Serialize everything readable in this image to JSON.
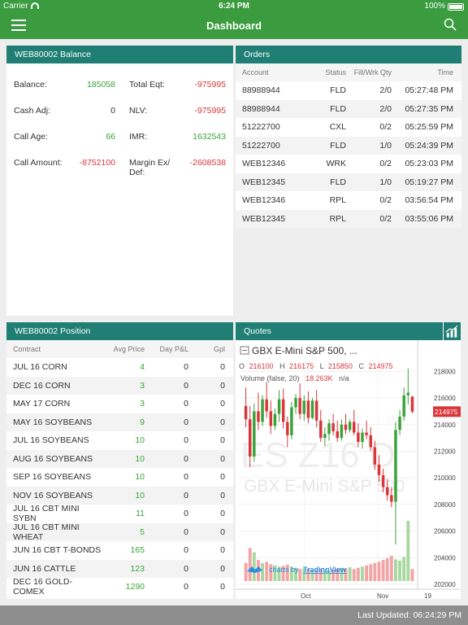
{
  "statusbar": {
    "carrier": "Carrier",
    "time": "6:24 PM",
    "battery": "100%"
  },
  "nav": {
    "title": "Dashboard"
  },
  "balance": {
    "header": "WEB80002 Balance",
    "rows": [
      {
        "l1": "Balance:",
        "v1": "185058",
        "l2": "Total Eqt:",
        "v2": "-975995"
      },
      {
        "l1": "Cash Adj:",
        "v1": "0",
        "l2": "NLV:",
        "v2": "-975995"
      },
      {
        "l1": "Call Age:",
        "v1": "66",
        "l2": "IMR:",
        "v2": "1632543"
      },
      {
        "l1": "Call Amount:",
        "v1": "-8752100",
        "l2": "Margin Ex/ Def:",
        "v2": "-2608538"
      }
    ]
  },
  "orders": {
    "header": "Orders",
    "columns": [
      "Account",
      "Status",
      "Fill/Wrk Qty",
      "Time"
    ],
    "rows": [
      [
        "88988944",
        "FLD",
        "2/0",
        "05:27:48 PM"
      ],
      [
        "88988944",
        "FLD",
        "2/0",
        "05:27:35 PM"
      ],
      [
        "51222700",
        "CXL",
        "0/2",
        "05:25:59 PM"
      ],
      [
        "51222700",
        "FLD",
        "1/0",
        "05:24:39 PM"
      ],
      [
        "WEB12346",
        "WRK",
        "0/2",
        "05:23:03 PM"
      ],
      [
        "WEB12345",
        "FLD",
        "1/0",
        "05:19:27 PM"
      ],
      [
        "WEB12346",
        "RPL",
        "0/2",
        "03:56:54 PM"
      ],
      [
        "WEB12345",
        "RPL",
        "0/2",
        "03:55:06 PM"
      ]
    ]
  },
  "position": {
    "header": "WEB80002 Position",
    "columns": [
      "Contract",
      "Avg Price",
      "Day P&L",
      "Gpl"
    ],
    "rows": [
      [
        "JUL 16 CORN",
        "4",
        "0",
        "0"
      ],
      [
        "DEC 16 CORN",
        "3",
        "0",
        "0"
      ],
      [
        "MAY 17 CORN",
        "3",
        "0",
        "0"
      ],
      [
        "MAY 16 SOYBEANS",
        "9",
        "0",
        "0"
      ],
      [
        "JUL 16 SOYBEANS",
        "10",
        "0",
        "0"
      ],
      [
        "AUG 16 SOYBEANS",
        "10",
        "0",
        "0"
      ],
      [
        "SEP 16 SOYBEANS",
        "10",
        "0",
        "0"
      ],
      [
        "NOV 16 SOYBEANS",
        "10",
        "0",
        "0"
      ],
      [
        "JUL 16 CBT MINI SYBN",
        "11",
        "0",
        "0"
      ],
      [
        "JUL 16 CBT MINI WHEAT",
        "5",
        "0",
        "0"
      ],
      [
        "JUN 16 CBT T-BONDS",
        "165",
        "0",
        "0"
      ],
      [
        "JUN 16 CATTLE",
        "123",
        "0",
        "0"
      ],
      [
        "DEC 16 GOLD-COMEX",
        "1290",
        "0",
        "0"
      ]
    ]
  },
  "quotes": {
    "header": "Quotes",
    "chart_icon": "chart-icon",
    "symbol_title": "GBX E-Mini S&P 500, ...",
    "ohlc": {
      "o_label": "O",
      "o": "216100",
      "h_label": "H",
      "h": "216175",
      "l_label": "L",
      "l": "215850",
      "c_label": "C",
      "c": "214975"
    },
    "volume_label": "Volume (false, 20)",
    "volume_value": "18.263K",
    "volume_na": "n/a",
    "watermark_1": "ES Z16 D",
    "watermark_2": "GBX E-Mini S&P 500",
    "branding_prefix": "charts by",
    "branding": "TradingView",
    "current_price": "214975",
    "colors": {
      "up": "#3ba33a",
      "down": "#d9363a",
      "vol_up": "#a7d89f",
      "vol_down": "#f2a4a6"
    }
  },
  "chart_data": {
    "type": "candlestick",
    "title": "GBX E-Mini S&P 500, ...",
    "y_ticks": [
      "218000",
      "216000",
      "214000",
      "212000",
      "210000",
      "208000",
      "206000",
      "204000",
      "202000"
    ],
    "ylim": [
      202000,
      219000
    ],
    "x_ticks": [
      "Oct",
      "Nov",
      "19"
    ],
    "candles": [
      {
        "o": 215400,
        "h": 216800,
        "l": 213800,
        "c": 214400
      },
      {
        "o": 214400,
        "h": 215400,
        "l": 210800,
        "c": 211600
      },
      {
        "o": 211600,
        "h": 215600,
        "l": 211200,
        "c": 215000
      },
      {
        "o": 215000,
        "h": 216400,
        "l": 213600,
        "c": 214200
      },
      {
        "o": 214200,
        "h": 216200,
        "l": 213900,
        "c": 215900
      },
      {
        "o": 215900,
        "h": 217200,
        "l": 214500,
        "c": 215000
      },
      {
        "o": 215000,
        "h": 215800,
        "l": 213300,
        "c": 213900
      },
      {
        "o": 213900,
        "h": 215200,
        "l": 213600,
        "c": 214800
      },
      {
        "o": 214800,
        "h": 216600,
        "l": 214200,
        "c": 215900
      },
      {
        "o": 215900,
        "h": 216700,
        "l": 213700,
        "c": 214200
      },
      {
        "o": 214200,
        "h": 214600,
        "l": 212300,
        "c": 213200
      },
      {
        "o": 213200,
        "h": 215700,
        "l": 212900,
        "c": 215300
      },
      {
        "o": 215300,
        "h": 216300,
        "l": 214800,
        "c": 216000
      },
      {
        "o": 216000,
        "h": 217100,
        "l": 214400,
        "c": 214800
      },
      {
        "o": 214800,
        "h": 216200,
        "l": 214300,
        "c": 215800
      },
      {
        "o": 215800,
        "h": 216500,
        "l": 214100,
        "c": 214500
      },
      {
        "o": 214500,
        "h": 216000,
        "l": 214400,
        "c": 215800
      },
      {
        "o": 215800,
        "h": 216600,
        "l": 213800,
        "c": 214300
      },
      {
        "o": 214300,
        "h": 215100,
        "l": 212700,
        "c": 213000
      },
      {
        "o": 213000,
        "h": 213800,
        "l": 212400,
        "c": 213300
      },
      {
        "o": 213300,
        "h": 214400,
        "l": 212800,
        "c": 214100
      },
      {
        "o": 214100,
        "h": 214800,
        "l": 213200,
        "c": 213500
      },
      {
        "o": 213500,
        "h": 214300,
        "l": 212700,
        "c": 213000
      },
      {
        "o": 213000,
        "h": 214400,
        "l": 212800,
        "c": 214000
      },
      {
        "o": 214000,
        "h": 214800,
        "l": 213300,
        "c": 213600
      },
      {
        "o": 213600,
        "h": 214400,
        "l": 213400,
        "c": 214200
      },
      {
        "o": 214200,
        "h": 215100,
        "l": 213200,
        "c": 213400
      },
      {
        "o": 213400,
        "h": 214100,
        "l": 212300,
        "c": 212700
      },
      {
        "o": 212700,
        "h": 213700,
        "l": 212200,
        "c": 213400
      },
      {
        "o": 213400,
        "h": 214300,
        "l": 212900,
        "c": 213200
      },
      {
        "o": 213200,
        "h": 213800,
        "l": 212000,
        "c": 212300
      },
      {
        "o": 212300,
        "h": 212800,
        "l": 210600,
        "c": 211000
      },
      {
        "o": 211000,
        "h": 211700,
        "l": 209700,
        "c": 210200
      },
      {
        "o": 210200,
        "h": 210700,
        "l": 208900,
        "c": 209300
      },
      {
        "o": 209300,
        "h": 209900,
        "l": 208300,
        "c": 208700
      },
      {
        "o": 208700,
        "h": 209300,
        "l": 207800,
        "c": 208200
      },
      {
        "o": 208200,
        "h": 214200,
        "l": 205000,
        "c": 213600
      },
      {
        "o": 213600,
        "h": 215100,
        "l": 213200,
        "c": 214600
      },
      {
        "o": 214600,
        "h": 216800,
        "l": 214300,
        "c": 216200
      },
      {
        "o": 216200,
        "h": 218200,
        "l": 215500,
        "c": 216400
      },
      {
        "o": 216100,
        "h": 216175,
        "l": 214850,
        "c": 214975
      }
    ],
    "volume": [
      0.3,
      0.55,
      0.48,
      0.35,
      0.3,
      0.32,
      0.28,
      0.26,
      0.24,
      0.25,
      0.27,
      0.24,
      0.22,
      0.2,
      0.21,
      0.2,
      0.18,
      0.19,
      0.2,
      0.18,
      0.17,
      0.19,
      0.2,
      0.22,
      0.21,
      0.23,
      0.2,
      0.22,
      0.24,
      0.26,
      0.28,
      0.3,
      0.32,
      0.35,
      0.38,
      0.42,
      0.36,
      0.34,
      0.4,
      1.0,
      0.2
    ]
  },
  "footer": {
    "last_updated": "Last Updated: 06:24:29 PM"
  }
}
